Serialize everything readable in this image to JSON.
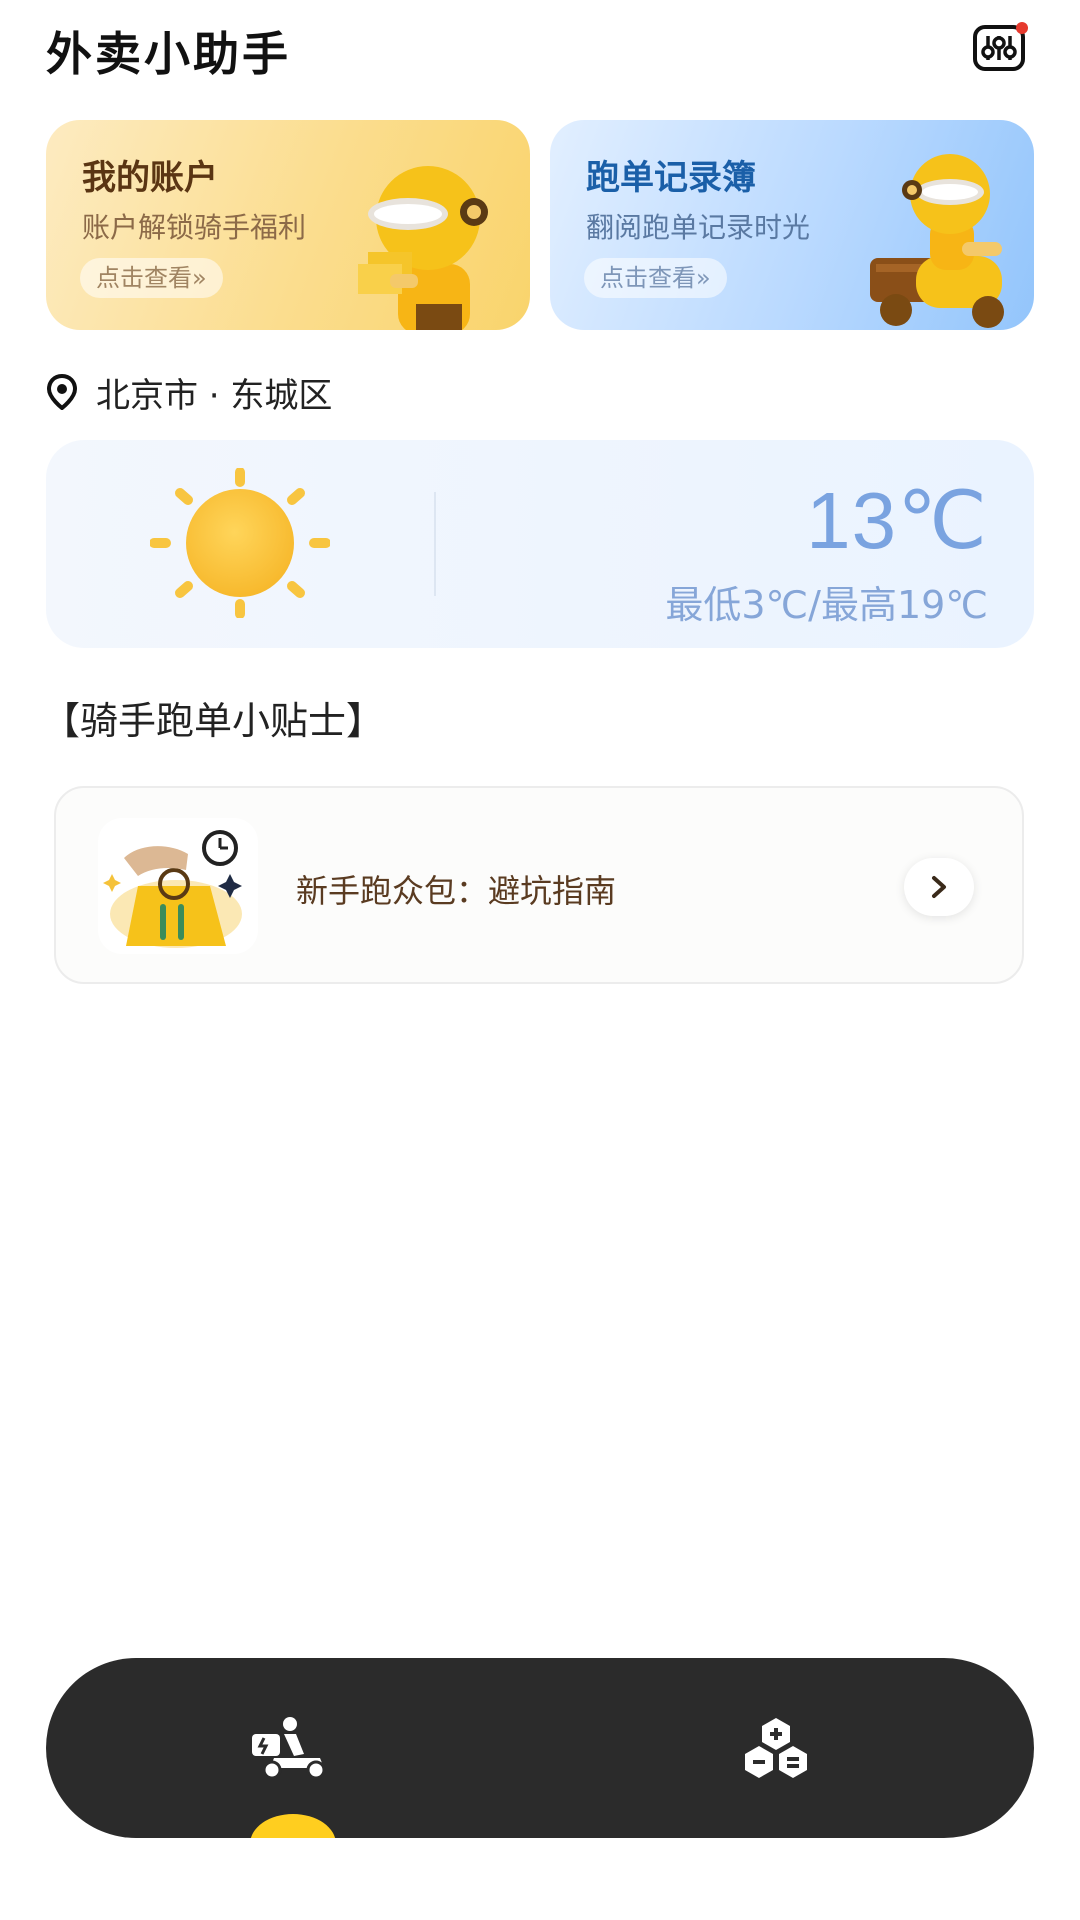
{
  "header": {
    "title": "外卖小助手",
    "filter_icon": "sliders-filter-icon",
    "notification_dot_color": "#e63a2e"
  },
  "cards": {
    "account": {
      "title": "我的账户",
      "subtitle": "账户解锁骑手福利",
      "cta": "点击查看»",
      "icon": "delivery-rider-holding-package-icon"
    },
    "record": {
      "title": "跑单记录簿",
      "subtitle": "翻阅跑单记录时光",
      "cta": "点击查看»",
      "icon": "delivery-rider-on-scooter-icon"
    }
  },
  "location": {
    "icon": "location-pin-icon",
    "text": "北京市 · 东城区"
  },
  "weather": {
    "icon": "sun-icon",
    "temperature": "13℃",
    "range": "最低3℃/最高19℃"
  },
  "tips": {
    "section_title": "【骑手跑单小贴士】",
    "items": [
      {
        "text": "新手跑众包：避坑指南",
        "icon": "delivery-bag-timer-icon",
        "arrow_icon": "chevron-right-icon"
      }
    ]
  },
  "bottom_nav": {
    "items": [
      {
        "icon": "delivery-scooter-icon",
        "active": true
      },
      {
        "icon": "tools-blocks-icon",
        "active": false
      }
    ],
    "active_indicator_color": "#ffce1f"
  },
  "colors": {
    "account_card": "#fbdd8e",
    "record_card": "#b9d9ff",
    "weather_card": "#eaf3ff",
    "temperature_text": "#7aa3e0",
    "nav_background": "#2b2b2b"
  }
}
